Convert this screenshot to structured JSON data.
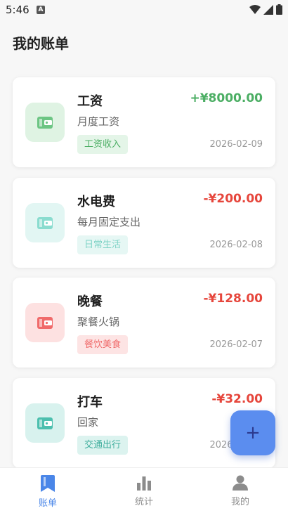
{
  "status_bar": {
    "time": "5:46",
    "notification_letter": "A"
  },
  "page": {
    "title": "我的账单"
  },
  "bills": [
    {
      "title": "工资",
      "description": "月度工资",
      "tag": "工资收入",
      "amount": "+¥8000.00",
      "date": "2026-02-09",
      "colors": {
        "icon_bg": "#dff3e3",
        "icon": "#6cc583",
        "tag_bg": "#e4f5e8",
        "tag_text": "#4cae64",
        "amount": "#4cae64"
      }
    },
    {
      "title": "水电费",
      "description": "每月固定支出",
      "tag": "日常生活",
      "amount": "-¥200.00",
      "date": "2026-02-08",
      "colors": {
        "icon_bg": "#e2f6f3",
        "icon": "#8adccf",
        "tag_bg": "#e6f7f4",
        "tag_text": "#7fd3c6",
        "amount": "#e6463c"
      }
    },
    {
      "title": "晚餐",
      "description": "聚餐火锅",
      "tag": "餐饮美食",
      "amount": "-¥128.00",
      "date": "2026-02-07",
      "colors": {
        "icon_bg": "#fde1e1",
        "icon": "#f06a6a",
        "tag_bg": "#fde4e4",
        "tag_text": "#f06a6a",
        "amount": "#e6463c"
      }
    },
    {
      "title": "打车",
      "description": "回家",
      "tag": "交通出行",
      "amount": "-¥32.00",
      "date": "2026-02-06",
      "colors": {
        "icon_bg": "#d8f2ee",
        "icon": "#4cbfae",
        "tag_bg": "#dcf3ef",
        "tag_text": "#3fae9d",
        "amount": "#e6463c"
      }
    }
  ],
  "fab": {
    "label": "+"
  },
  "nav": [
    {
      "label": "账单",
      "icon": "bookmark-icon",
      "active": true
    },
    {
      "label": "统计",
      "icon": "bar-chart-icon",
      "active": false
    },
    {
      "label": "我的",
      "icon": "person-icon",
      "active": false
    }
  ],
  "theme": {
    "active": "#4a86e8",
    "inactive": "#8c8c8c"
  }
}
